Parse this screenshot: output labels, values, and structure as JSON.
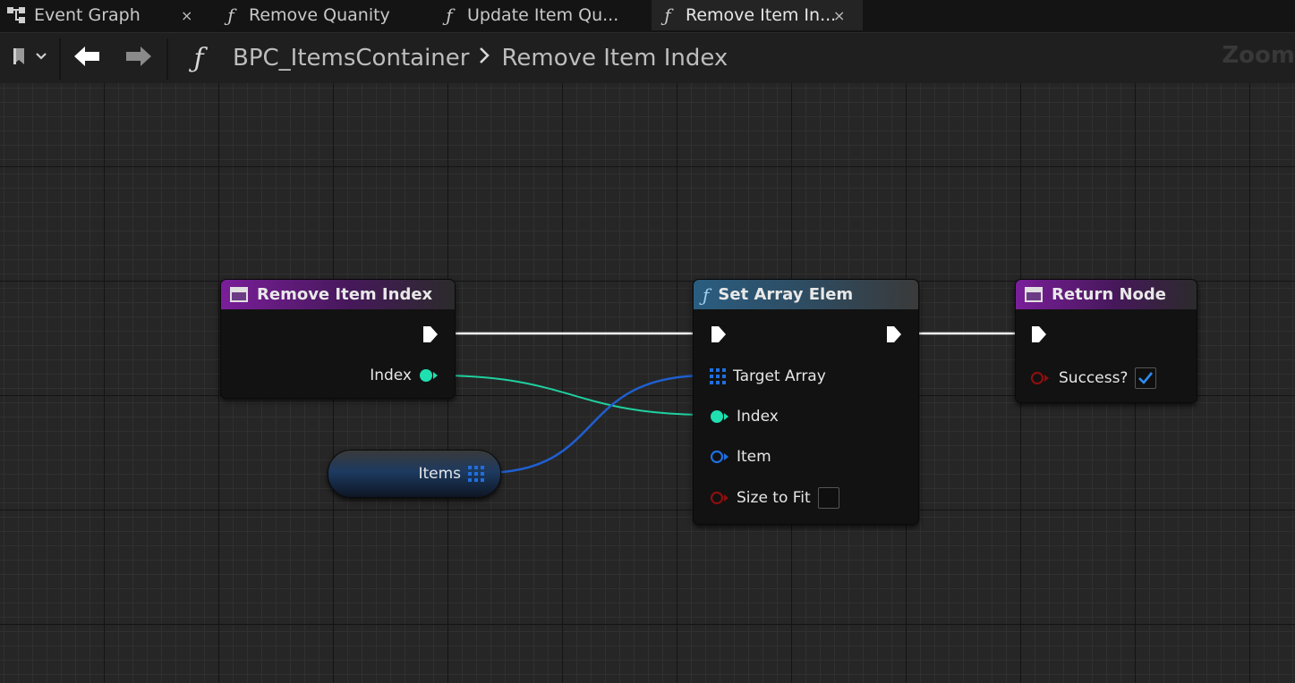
{
  "tabs": [
    {
      "label": "Event Graph",
      "icon": "event-graph-icon",
      "active": false,
      "close": "×"
    },
    {
      "label": "Remove Quanity",
      "icon": "function-icon",
      "active": false
    },
    {
      "label": "Update Item Qu...",
      "icon": "function-icon",
      "active": false
    },
    {
      "label": "Remove Item In...",
      "icon": "function-icon",
      "active": true,
      "close": "×"
    }
  ],
  "toolbar": {
    "bookmark_icon": "bookmark-icon",
    "back_icon": "back-arrow-icon",
    "forward_icon": "forward-arrow-icon",
    "function_icon": "function-icon",
    "breadcrumb": [
      "BPC_ItemsContainer",
      "Remove Item Index"
    ],
    "zoom_label": "Zoom"
  },
  "nodes": {
    "entry": {
      "title": "Remove Item Index",
      "pin_index": "Index"
    },
    "set_array_elem": {
      "title": "Set Array Elem",
      "pin_target": "Target Array",
      "pin_index": "Index",
      "pin_item": "Item",
      "pin_size_to_fit": "Size to Fit",
      "size_to_fit_checked": false
    },
    "return": {
      "title": "Return Node",
      "pin_success": "Success?",
      "success_checked": true
    },
    "items_var": {
      "label": "Items"
    }
  },
  "colors": {
    "exec_wire": "#ffffff",
    "int_pin": "#1fe0b0",
    "array_pin": "#1f6fe0",
    "struct_pin": "#1f6fe0",
    "bool_pin": "#8a0f0f",
    "entry_header": "#7a1e9a",
    "function_header": "#2a5d80"
  }
}
